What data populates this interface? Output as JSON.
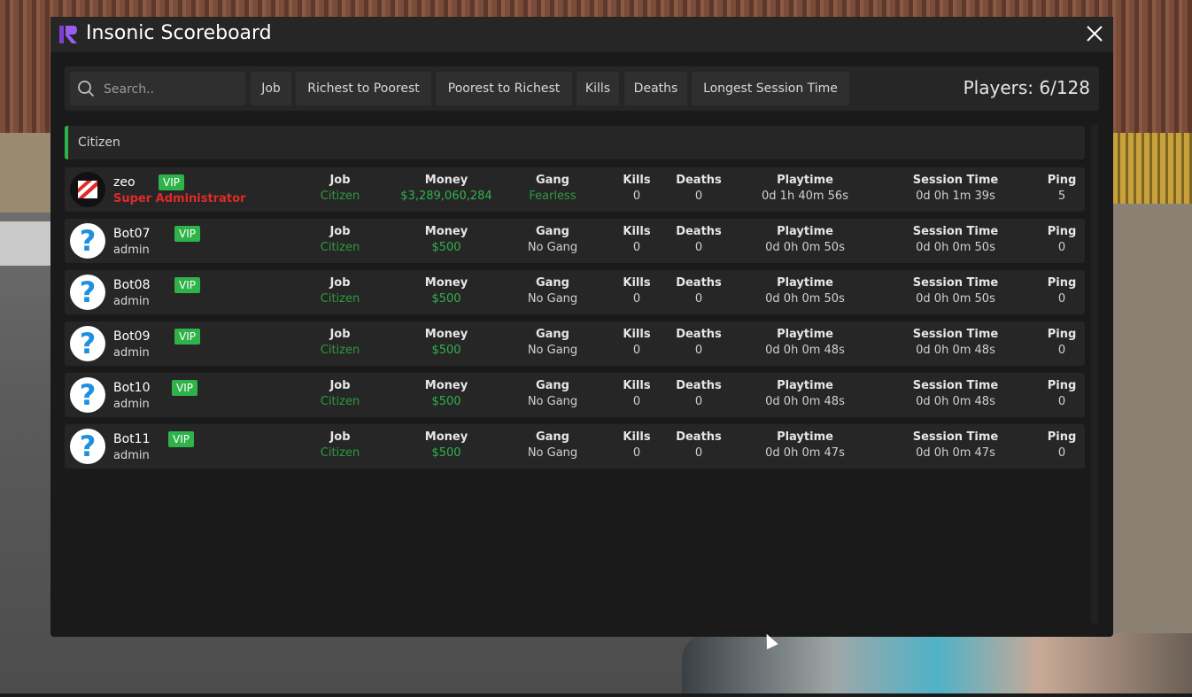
{
  "window": {
    "title": "Insonic Scoreboard"
  },
  "toolbar": {
    "search_placeholder": "Search..",
    "sort_buttons": [
      "Job",
      "Richest to Poorest",
      "Poorest to Richest",
      "Kills",
      "Deaths",
      "Longest Session Time"
    ],
    "players_label": "Players: 6/128"
  },
  "columns": {
    "job": "Job",
    "money": "Money",
    "gang": "Gang",
    "kills": "Kills",
    "deaths": "Deaths",
    "playtime": "Playtime",
    "session": "Session Time",
    "ping": "Ping"
  },
  "category": {
    "name": "Citizen",
    "color": "#2fb24a"
  },
  "rows": [
    {
      "name": "zeo",
      "badge": "VIP",
      "rank": "Super Administrator",
      "avatar": "zeo-logo-icon",
      "job": "Citizen",
      "money": "$3,289,060,284",
      "gang": "Fearless",
      "kills": "0",
      "deaths": "0",
      "playtime": "0d 1h 40m 56s",
      "session": "0d 0h 1m 39s",
      "ping": "5"
    },
    {
      "name": "Bot07",
      "badge": "VIP",
      "rank": "admin",
      "avatar": "question-mark-icon",
      "job": "Citizen",
      "money": "$500",
      "gang": "No Gang",
      "kills": "0",
      "deaths": "0",
      "playtime": "0d 0h 0m 50s",
      "session": "0d 0h 0m 50s",
      "ping": "0"
    },
    {
      "name": "Bot08",
      "badge": "VIP",
      "rank": "admin",
      "avatar": "question-mark-icon",
      "job": "Citizen",
      "money": "$500",
      "gang": "No Gang",
      "kills": "0",
      "deaths": "0",
      "playtime": "0d 0h 0m 50s",
      "session": "0d 0h 0m 50s",
      "ping": "0"
    },
    {
      "name": "Bot09",
      "badge": "VIP",
      "rank": "admin",
      "avatar": "question-mark-icon",
      "job": "Citizen",
      "money": "$500",
      "gang": "No Gang",
      "kills": "0",
      "deaths": "0",
      "playtime": "0d 0h 0m 48s",
      "session": "0d 0h 0m 48s",
      "ping": "0"
    },
    {
      "name": "Bot10",
      "badge": "VIP",
      "rank": "admin",
      "avatar": "question-mark-icon",
      "job": "Citizen",
      "money": "$500",
      "gang": "No Gang",
      "kills": "0",
      "deaths": "0",
      "playtime": "0d 0h 0m 48s",
      "session": "0d 0h 0m 48s",
      "ping": "0"
    },
    {
      "name": "Bot11",
      "badge": "VIP",
      "rank": "admin",
      "avatar": "question-mark-icon",
      "job": "Citizen",
      "money": "$500",
      "gang": "No Gang",
      "kills": "0",
      "deaths": "0",
      "playtime": "0d 0h 0m 47s",
      "session": "0d 0h 0m 47s",
      "ping": "0"
    }
  ],
  "colors": {
    "vip": "#2fb24a",
    "admin_rank": "#e02a2a",
    "money": "#2fb24a",
    "question_icon": "#1f8fe0"
  }
}
